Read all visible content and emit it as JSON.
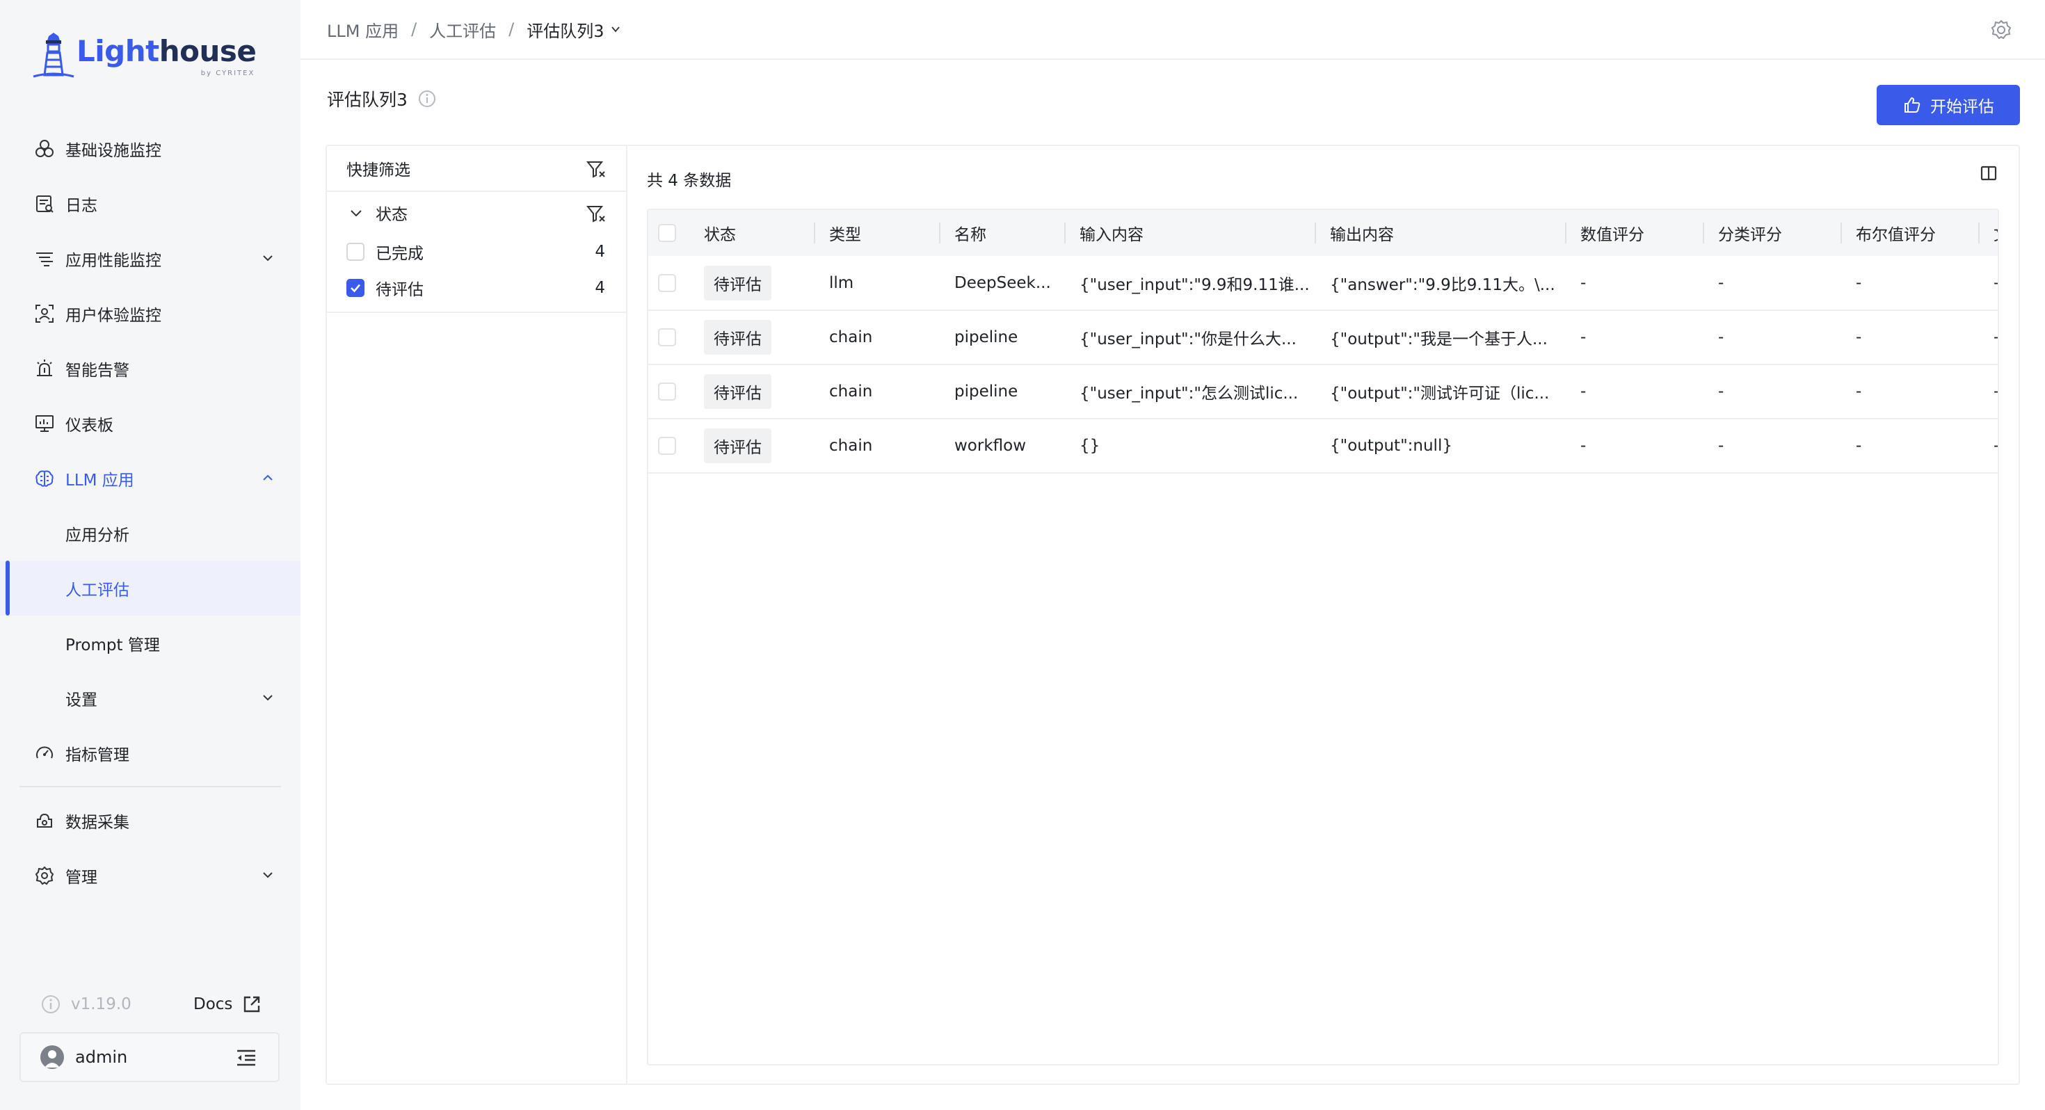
{
  "brand": {
    "name_part1": "Light",
    "name_part2": "house",
    "byline": "by CYRITEX"
  },
  "sidebar": {
    "items": [
      {
        "label": "基础设施监控",
        "icon": "infrastructure-icon"
      },
      {
        "label": "日志",
        "icon": "log-icon"
      },
      {
        "label": "应用性能监控",
        "icon": "apm-icon",
        "expandable": true
      },
      {
        "label": "用户体验监控",
        "icon": "user-experience-icon"
      },
      {
        "label": "智能告警",
        "icon": "alarm-icon"
      },
      {
        "label": "仪表板",
        "icon": "dashboard-icon"
      },
      {
        "label": "LLM 应用",
        "icon": "llm-brain-icon",
        "expanded": true
      }
    ],
    "llm_sub": [
      {
        "label": "应用分析"
      },
      {
        "label": "人工评估",
        "selected": true
      },
      {
        "label": "Prompt 管理"
      },
      {
        "label": "设置",
        "expandable": true
      }
    ],
    "items_after": [
      {
        "label": "指标管理",
        "icon": "metrics-icon"
      }
    ],
    "items_bottom": [
      {
        "label": "数据采集",
        "icon": "data-collect-icon"
      },
      {
        "label": "管理",
        "icon": "admin-gear-icon",
        "expandable": true
      }
    ],
    "version": "v1.19.0",
    "docs_label": "Docs",
    "user": "admin"
  },
  "breadcrumb": {
    "level1": "LLM 应用",
    "level2": "人工评估",
    "level3": "评估队列3",
    "separator": "/"
  },
  "page": {
    "title": "评估队列3",
    "start_button": "开始评估",
    "accent": "#3a5bea"
  },
  "filter": {
    "title": "快捷筛选",
    "group_label": "状态",
    "options": [
      {
        "label": "已完成",
        "count": "4",
        "checked": false
      },
      {
        "label": "待评估",
        "count": "4",
        "checked": true
      }
    ]
  },
  "table": {
    "total_text": "共 4 条数据",
    "columns": [
      "状态",
      "类型",
      "名称",
      "输入内容",
      "输出内容",
      "数值评分",
      "分类评分",
      "布尔值评分",
      "文"
    ],
    "rows": [
      {
        "status": "待评估",
        "type": "llm",
        "name": "DeepSeek...",
        "input": "{\"user_input\":\"9.9和9.11谁...",
        "output": "{\"answer\":\"9.9比9.11大。\\...",
        "num": "-",
        "cat": "-",
        "bool": "-",
        "extra": "-"
      },
      {
        "status": "待评估",
        "type": "chain",
        "name": "pipeline",
        "input": "{\"user_input\":\"你是什么大...",
        "output": "{\"output\":\"我是一个基于人...",
        "num": "-",
        "cat": "-",
        "bool": "-",
        "extra": "-"
      },
      {
        "status": "待评估",
        "type": "chain",
        "name": "pipeline",
        "input": "{\"user_input\":\"怎么测试lic...",
        "output": "{\"output\":\"测试许可证（lic...",
        "num": "-",
        "cat": "-",
        "bool": "-",
        "extra": "-"
      },
      {
        "status": "待评估",
        "type": "chain",
        "name": "workflow",
        "input": "{}",
        "output": "{\"output\":null}",
        "num": "-",
        "cat": "-",
        "bool": "-",
        "extra": "-"
      }
    ]
  }
}
